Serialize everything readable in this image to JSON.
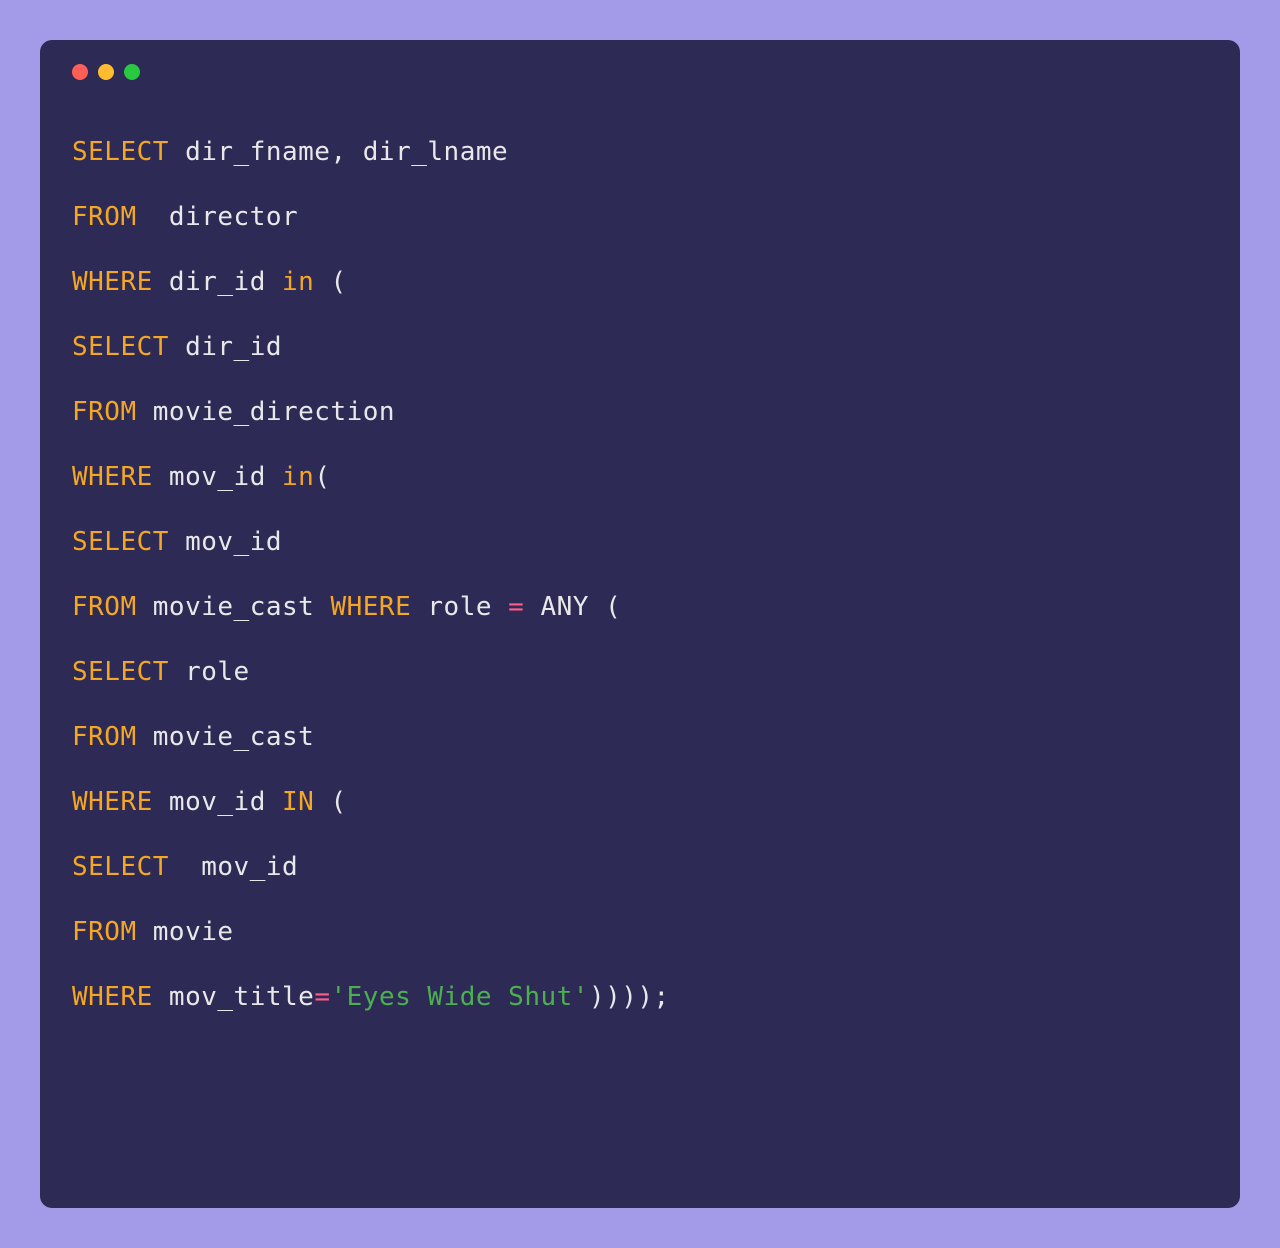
{
  "window": {
    "traffic_lights": {
      "red": "close",
      "yellow": "minimize",
      "green": "maximize"
    }
  },
  "code": {
    "lines": [
      {
        "tokens": [
          {
            "t": "keyword",
            "v": "SELECT"
          },
          {
            "t": "identifier",
            "v": " dir_fname"
          },
          {
            "t": "punct",
            "v": ","
          },
          {
            "t": "identifier",
            "v": " dir_lname"
          }
        ]
      },
      {
        "tokens": [
          {
            "t": "keyword",
            "v": "FROM"
          },
          {
            "t": "identifier",
            "v": "  director"
          }
        ]
      },
      {
        "tokens": [
          {
            "t": "keyword",
            "v": "WHERE"
          },
          {
            "t": "identifier",
            "v": " dir_id "
          },
          {
            "t": "in-keyword",
            "v": "in"
          },
          {
            "t": "punct",
            "v": " ("
          }
        ]
      },
      {
        "tokens": [
          {
            "t": "keyword",
            "v": "SELECT"
          },
          {
            "t": "identifier",
            "v": " dir_id "
          }
        ]
      },
      {
        "tokens": [
          {
            "t": "keyword",
            "v": "FROM"
          },
          {
            "t": "identifier",
            "v": " movie_direction"
          }
        ]
      },
      {
        "tokens": [
          {
            "t": "keyword",
            "v": "WHERE"
          },
          {
            "t": "identifier",
            "v": " mov_id "
          },
          {
            "t": "in-keyword",
            "v": "in"
          },
          {
            "t": "punct",
            "v": "("
          }
        ]
      },
      {
        "tokens": [
          {
            "t": "keyword",
            "v": "SELECT"
          },
          {
            "t": "identifier",
            "v": " mov_id "
          }
        ]
      },
      {
        "tokens": [
          {
            "t": "keyword",
            "v": "FROM"
          },
          {
            "t": "identifier",
            "v": " movie_cast "
          },
          {
            "t": "keyword",
            "v": "WHERE"
          },
          {
            "t": "identifier",
            "v": " role "
          },
          {
            "t": "equals",
            "v": "="
          },
          {
            "t": "any-keyword",
            "v": " ANY "
          },
          {
            "t": "punct",
            "v": "("
          }
        ]
      },
      {
        "tokens": [
          {
            "t": "keyword",
            "v": "SELECT"
          },
          {
            "t": "identifier",
            "v": " role "
          }
        ]
      },
      {
        "tokens": [
          {
            "t": "keyword",
            "v": "FROM"
          },
          {
            "t": "identifier",
            "v": " movie_cast "
          }
        ]
      },
      {
        "tokens": [
          {
            "t": "keyword",
            "v": "WHERE"
          },
          {
            "t": "identifier",
            "v": " mov_id "
          },
          {
            "t": "keyword",
            "v": "IN"
          },
          {
            "t": "punct",
            "v": " ("
          }
        ]
      },
      {
        "tokens": [
          {
            "t": "keyword",
            "v": "SELECT"
          },
          {
            "t": "identifier",
            "v": "  mov_id "
          }
        ]
      },
      {
        "tokens": [
          {
            "t": "keyword",
            "v": "FROM"
          },
          {
            "t": "identifier",
            "v": " movie "
          }
        ]
      },
      {
        "tokens": [
          {
            "t": "keyword",
            "v": "WHERE"
          },
          {
            "t": "identifier",
            "v": " mov_title"
          },
          {
            "t": "equals",
            "v": "="
          },
          {
            "t": "string",
            "v": "'Eyes Wide Shut'"
          },
          {
            "t": "punct",
            "v": "))));"
          }
        ]
      }
    ]
  }
}
